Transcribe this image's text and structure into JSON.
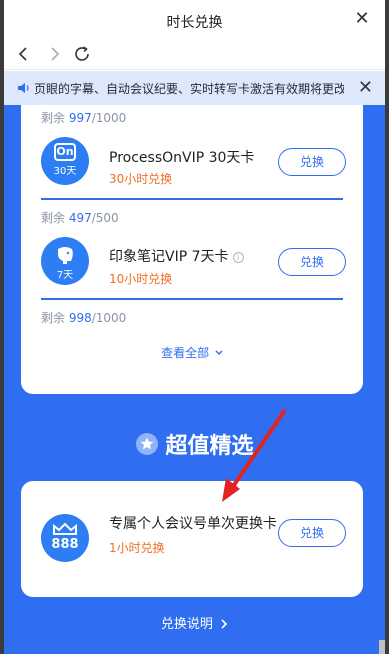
{
  "window": {
    "title": "时长兑换"
  },
  "notice": {
    "text": "页眼的字幕、自动会议纪要、实时转写卡激活有效期将更改"
  },
  "featured": {
    "top_remaining": {
      "current": "997",
      "total": "/1000",
      "prefix": "剩余 "
    },
    "items": [
      {
        "logo_text": "On",
        "logo_sub": "30天",
        "name": "ProcessOnVIP 30天卡",
        "duration": "30小时兑换",
        "button": "兑换",
        "remaining_prefix": "剩余 ",
        "remaining_current": "497",
        "remaining_total": "/500"
      },
      {
        "logo_text": "",
        "logo_sub": "7天",
        "name": "印象笔记VIP 7天卡",
        "info_icon": "i",
        "duration": "10小时兑换",
        "button": "兑换",
        "remaining_prefix": "剩余 ",
        "remaining_current": "998",
        "remaining_total": "/1000"
      }
    ],
    "view_all": "查看全部",
    "view_all_icon": "chevron-down-icon"
  },
  "value_pick": {
    "heading": "超值精选",
    "item": {
      "logo_text": "888",
      "name": "专属个人会议号单次更换卡",
      "duration": "1小时兑换",
      "button": "兑换"
    }
  },
  "footer": {
    "explain": "兑换说明"
  },
  "colors": {
    "primary": "#2f6ef0",
    "accent_orange": "#f06f25",
    "notice_bg": "#dde9fb"
  }
}
